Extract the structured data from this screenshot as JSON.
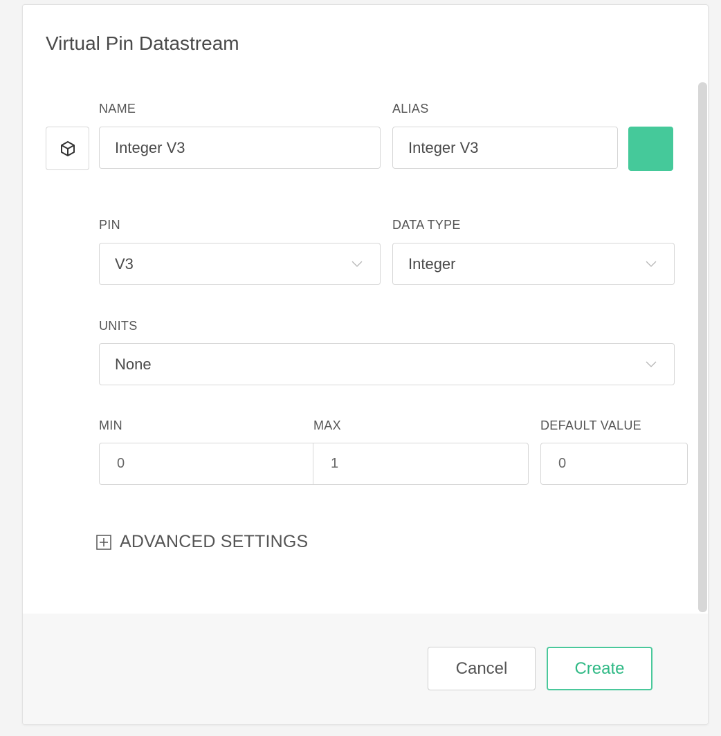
{
  "dialog": {
    "title": "Virtual Pin Datastream"
  },
  "colors": {
    "swatch": "#45c99a",
    "accent": "#2fb985"
  },
  "icons": {
    "datastream": "cube-icon",
    "dropdown": "chevron-down-icon",
    "expand": "plus-square-icon"
  },
  "name": {
    "label": "NAME",
    "value": "Integer V3"
  },
  "alias": {
    "label": "ALIAS",
    "value": "Integer V3"
  },
  "pin": {
    "label": "PIN",
    "value": "V3"
  },
  "data_type": {
    "label": "DATA TYPE",
    "value": "Integer"
  },
  "units": {
    "label": "UNITS",
    "value": "None"
  },
  "min": {
    "label": "MIN",
    "value": "0"
  },
  "max": {
    "label": "MAX",
    "value": "1"
  },
  "default_value": {
    "label": "DEFAULT VALUE",
    "value": "0"
  },
  "advanced": {
    "label": "ADVANCED SETTINGS"
  },
  "footer": {
    "cancel_label": "Cancel",
    "create_label": "Create"
  }
}
